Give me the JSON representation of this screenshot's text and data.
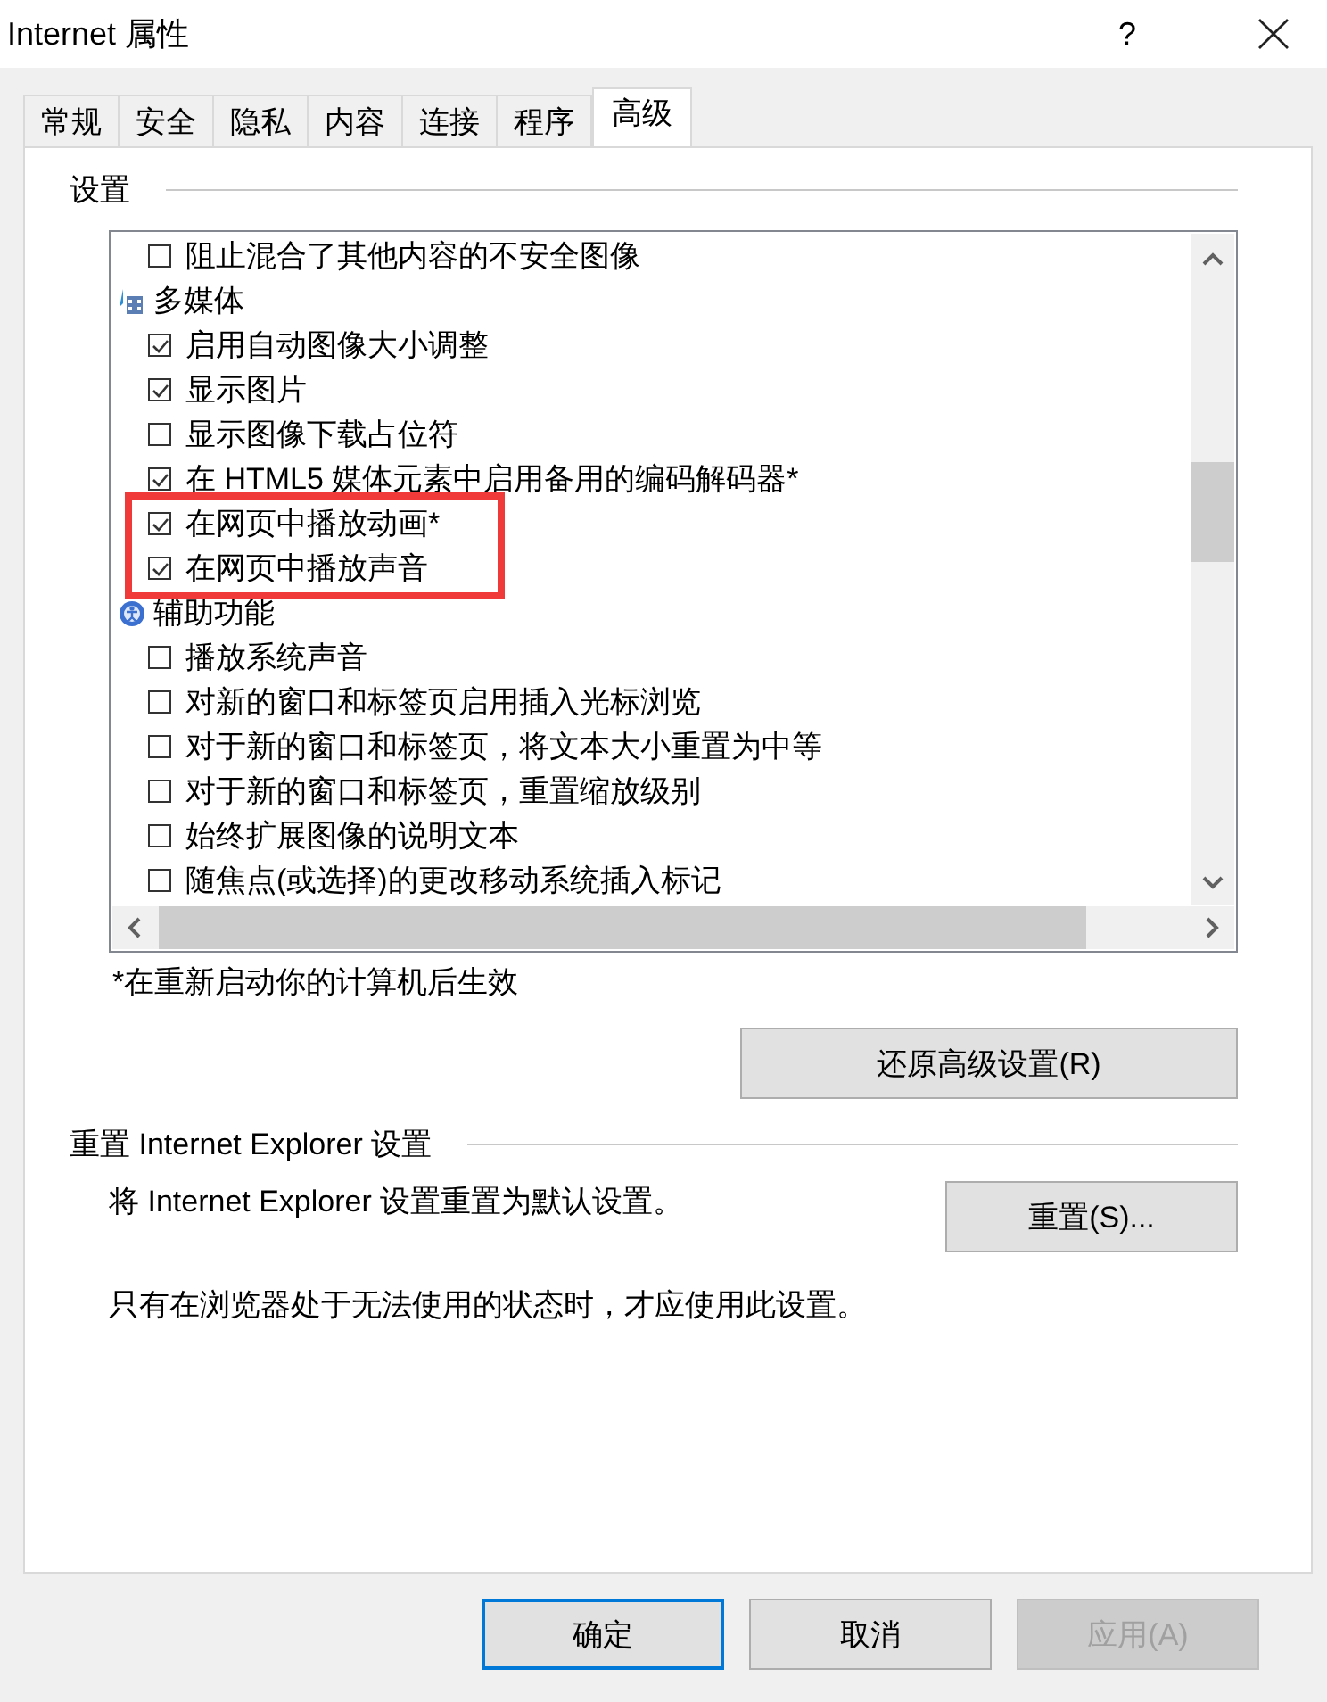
{
  "window": {
    "title": "Internet 属性",
    "help": "?"
  },
  "tabs": [
    {
      "label": "常规",
      "selected": false
    },
    {
      "label": "安全",
      "selected": false
    },
    {
      "label": "隐私",
      "selected": false
    },
    {
      "label": "内容",
      "selected": false
    },
    {
      "label": "连接",
      "selected": false
    },
    {
      "label": "程序",
      "selected": false
    },
    {
      "label": "高级",
      "selected": true
    }
  ],
  "settings": {
    "title": "设置",
    "items": [
      {
        "kind": "checkbox",
        "label": "阻止混合了其他内容的不安全图像",
        "checked": false,
        "highlighted": false
      },
      {
        "kind": "category",
        "label": "多媒体"
      },
      {
        "kind": "checkbox",
        "label": "启用自动图像大小调整",
        "checked": true,
        "highlighted": false
      },
      {
        "kind": "checkbox",
        "label": "显示图片",
        "checked": true,
        "highlighted": false
      },
      {
        "kind": "checkbox",
        "label": "显示图像下载占位符",
        "checked": false,
        "highlighted": false
      },
      {
        "kind": "checkbox",
        "label": "在 HTML5 媒体元素中启用备用的编码解码器*",
        "checked": true,
        "highlighted": false
      },
      {
        "kind": "checkbox",
        "label": "在网页中播放动画*",
        "checked": true,
        "highlighted": true
      },
      {
        "kind": "checkbox",
        "label": "在网页中播放声音",
        "checked": true,
        "highlighted": true
      },
      {
        "kind": "category",
        "label": "辅助功能"
      },
      {
        "kind": "checkbox",
        "label": "播放系统声音",
        "checked": false,
        "highlighted": false
      },
      {
        "kind": "checkbox",
        "label": "对新的窗口和标签页启用插入光标浏览",
        "checked": false,
        "highlighted": false
      },
      {
        "kind": "checkbox",
        "label": "对于新的窗口和标签页，将文本大小重置为中等",
        "checked": false,
        "highlighted": false
      },
      {
        "kind": "checkbox",
        "label": "对于新的窗口和标签页，重置缩放级别",
        "checked": false,
        "highlighted": false
      },
      {
        "kind": "checkbox",
        "label": "始终扩展图像的说明文本",
        "checked": false,
        "highlighted": false
      },
      {
        "kind": "checkbox",
        "label": "随焦点(或选择)的更改移动系统插入标记",
        "checked": false,
        "highlighted": false
      }
    ],
    "note": "*在重新启动你的计算机后生效",
    "restore_button": "还原高级设置(R)"
  },
  "reset": {
    "title": "重置 Internet Explorer 设置",
    "description": "将 Internet Explorer 设置重置为默认设置。",
    "button": "重置(S)...",
    "note": "只有在浏览器处于无法使用的状态时，才应使用此设置。"
  },
  "buttons": [
    {
      "label": "确定",
      "kind": "default",
      "disabled": false
    },
    {
      "label": "取消",
      "kind": "normal",
      "disabled": false
    },
    {
      "label": "应用(A)",
      "kind": "normal",
      "disabled": true
    }
  ]
}
